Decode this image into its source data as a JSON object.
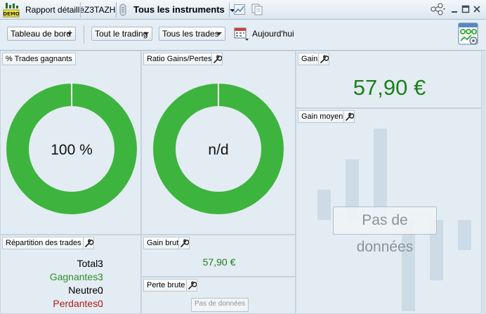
{
  "titlebar": {
    "demo_label": "DEMO",
    "report_title": "Rapport détaillé",
    "account": "Z3TAZH",
    "instruments": "Tous les instruments"
  },
  "toolbar": {
    "dashboard": "Tableau de bord",
    "trading": "Tout le trading",
    "trades": "Tous les trades",
    "period": "Aujourd'hui"
  },
  "panels": {
    "win_pct": {
      "title": "% Trades gagnants",
      "value": "100 %",
      "fraction": 1.0
    },
    "ratio": {
      "title": "Ratio Gains/Pertes",
      "value": "n/d",
      "fraction": 1.0
    },
    "gain": {
      "title": "Gain",
      "value": "57,90 €"
    },
    "avg_gain": {
      "title": "Gain moyen",
      "nodata": "Pas de données"
    },
    "distribution": {
      "title": "Répartition des trades",
      "rows": [
        {
          "label": "Total :",
          "value": "3",
          "color": "#000000"
        },
        {
          "label": "Gagnantes :",
          "value": "3",
          "color": "#2f8f2f"
        },
        {
          "label": "Neutre :",
          "value": "0",
          "color": "#000000"
        },
        {
          "label": "Perdantes :",
          "value": "0",
          "color": "#b01e1e"
        }
      ]
    },
    "gross_gain": {
      "title": "Gain brut",
      "value": "57,90 €"
    },
    "gross_loss": {
      "title": "Perte brute",
      "nodata": "Pas de données"
    }
  },
  "colors": {
    "green": "#3db43d",
    "gain_text": "#1e7e1e",
    "ghost_bar": "#ccdbe5"
  }
}
